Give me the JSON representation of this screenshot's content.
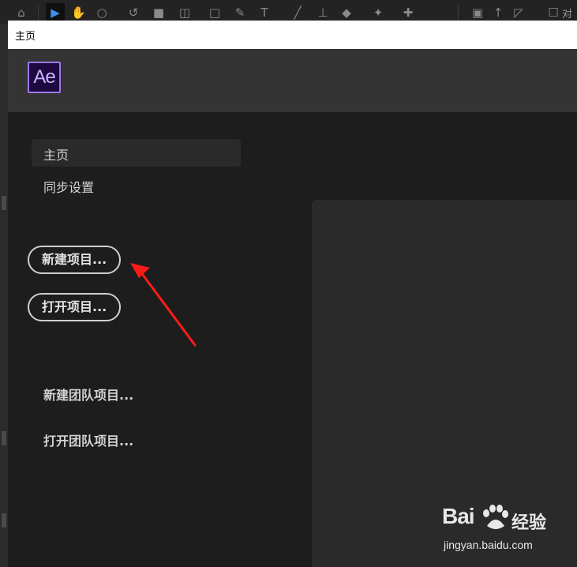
{
  "window": {
    "title": "主页"
  },
  "app": {
    "logo_text": "Ae",
    "accent_color": "#9c79e6"
  },
  "toolbar": {
    "icons": [
      "home-icon",
      "selection-tool-icon",
      "hand-tool-icon",
      "zoom-tool-icon",
      "rotate-tool-icon",
      "camera-tool-icon",
      "pan-behind-tool-icon",
      "rectangle-tool-icon",
      "pen-tool-icon",
      "type-tool-icon",
      "brush-tool-icon",
      "clone-stamp-tool-icon",
      "eraser-tool-icon",
      "roto-brush-tool-icon",
      "puppet-pin-tool-icon"
    ],
    "right_text": "对"
  },
  "sidebar": {
    "items": [
      {
        "label": "主页",
        "active": true
      },
      {
        "label": "同步设置",
        "active": false
      }
    ]
  },
  "actions": {
    "new_project": "新建项目...",
    "open_project": "打开项目...",
    "new_team_project": "新建团队项目...",
    "open_team_project": "打开团队项目..."
  },
  "watermark": {
    "logo_text": "Bai",
    "logo_text_2": "经验",
    "url": "jingyan.baidu.com"
  }
}
